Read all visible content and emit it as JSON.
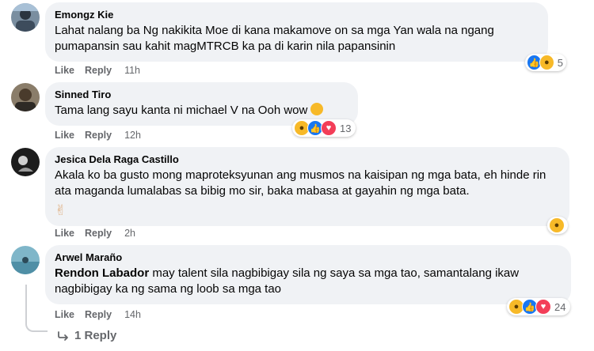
{
  "comments": [
    {
      "name": "Emongz Kie",
      "text": "Lahat nalang ba Ng nakikita Moe di kana makamove on sa mga Yan wala na ngang pumapansin sau kahit magMTRCB ka pa di karin nila papansinin",
      "like": "Like",
      "reply": "Reply",
      "time": "11h",
      "reactions": [
        "like",
        "haha"
      ],
      "reaction_count": "5"
    },
    {
      "name": "Sinned Tiro",
      "text": "Tama lang sayu kanta ni michael V na Ooh wow",
      "like": "Like",
      "reply": "Reply",
      "time": "12h",
      "reactions": [
        "haha",
        "like",
        "love"
      ],
      "reaction_count": "13"
    },
    {
      "name": "Jesica Dela Raga Castillo",
      "text": "Akala ko ba gusto mong maproteksyunan ang musmos na kaisipan ng mga bata, eh hinde rin ata maganda lumalabas sa bibig mo sir, baka mabasa at gayahin ng mga bata.",
      "emoji": "✌",
      "like": "Like",
      "reply": "Reply",
      "time": "2h",
      "reactions": [
        "haha"
      ]
    },
    {
      "name": "Arwel Maraño",
      "mention": "Rendon Labador",
      "text": " may talent sila nagbibigay sila ng saya sa mga tao, samantalang ikaw nagbibigay ka ng sama ng loob sa mga tao",
      "like": "Like",
      "reply": "Reply",
      "time": "14h",
      "reactions": [
        "haha",
        "like",
        "love"
      ],
      "reaction_count": "24"
    }
  ],
  "replies_link": "1 Reply",
  "colors": {
    "bubble": "#f0f2f5",
    "meta": "#65676b",
    "like": "#1877f2",
    "haha": "#f7b928",
    "love": "#f33e58"
  }
}
